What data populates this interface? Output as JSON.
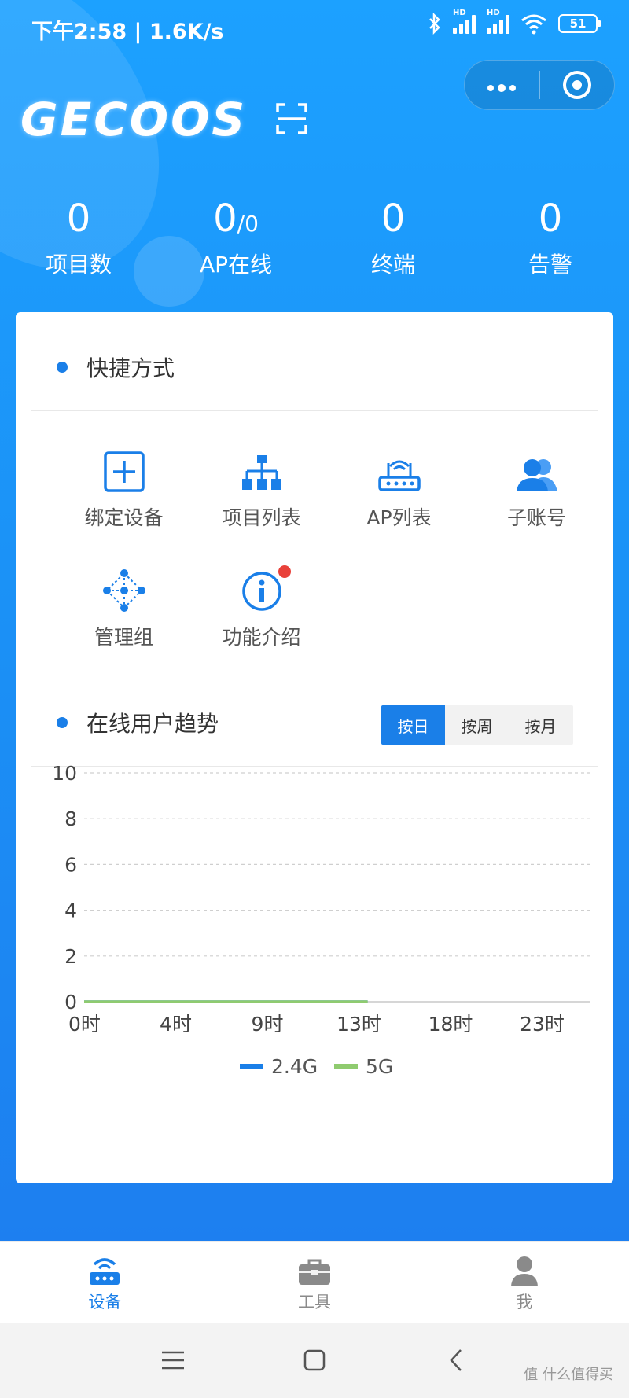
{
  "status_bar": {
    "time_speed": "下午2:58 | 1.6K/s",
    "battery": "51",
    "sim1": "HD",
    "sim2": "HD"
  },
  "brand": {
    "logo_text": "GECOOS",
    "accent_color": "#1a7fe8"
  },
  "stats": [
    {
      "value": "0",
      "suffix": "",
      "label": "项目数"
    },
    {
      "value": "0",
      "suffix": "/0",
      "label": "AP在线"
    },
    {
      "value": "0",
      "suffix": "",
      "label": "终端"
    },
    {
      "value": "0",
      "suffix": "",
      "label": "告警"
    }
  ],
  "shortcuts": {
    "title": "快捷方式",
    "items": [
      {
        "label": "绑定设备",
        "icon": "plus-square-icon"
      },
      {
        "label": "项目列表",
        "icon": "hierarchy-icon"
      },
      {
        "label": "AP列表",
        "icon": "router-icon"
      },
      {
        "label": "子账号",
        "icon": "users-icon"
      },
      {
        "label": "管理组",
        "icon": "network-icon"
      },
      {
        "label": "功能介绍",
        "icon": "info-icon"
      }
    ]
  },
  "trend": {
    "title": "在线用户趋势",
    "ranges": [
      "按日",
      "按周",
      "按月"
    ],
    "selected_range": "按日"
  },
  "chart_data": {
    "type": "line",
    "x": [
      "0时",
      "4时",
      "9时",
      "13时",
      "18时",
      "23时"
    ],
    "ylim": [
      0,
      10
    ],
    "yticks": [
      "0",
      "2",
      "4",
      "6",
      "8",
      "10"
    ],
    "series": [
      {
        "name": "2.4G",
        "color": "#1a7fe8",
        "values": [
          0,
          0,
          0,
          0
        ]
      },
      {
        "name": "5G",
        "color": "#8fcb6f",
        "values": [
          0,
          0,
          0,
          0
        ]
      }
    ],
    "x_values": [
      0,
      4,
      9,
      13
    ],
    "x_max": 23,
    "grid": true,
    "legend": "bottom"
  },
  "tabbar": {
    "tabs": [
      {
        "label": "设备",
        "icon": "router-icon",
        "active": true
      },
      {
        "label": "工具",
        "icon": "toolbox-icon",
        "active": false
      },
      {
        "label": "我",
        "icon": "user-icon",
        "active": false
      }
    ]
  },
  "watermark": "值 什么值得买"
}
